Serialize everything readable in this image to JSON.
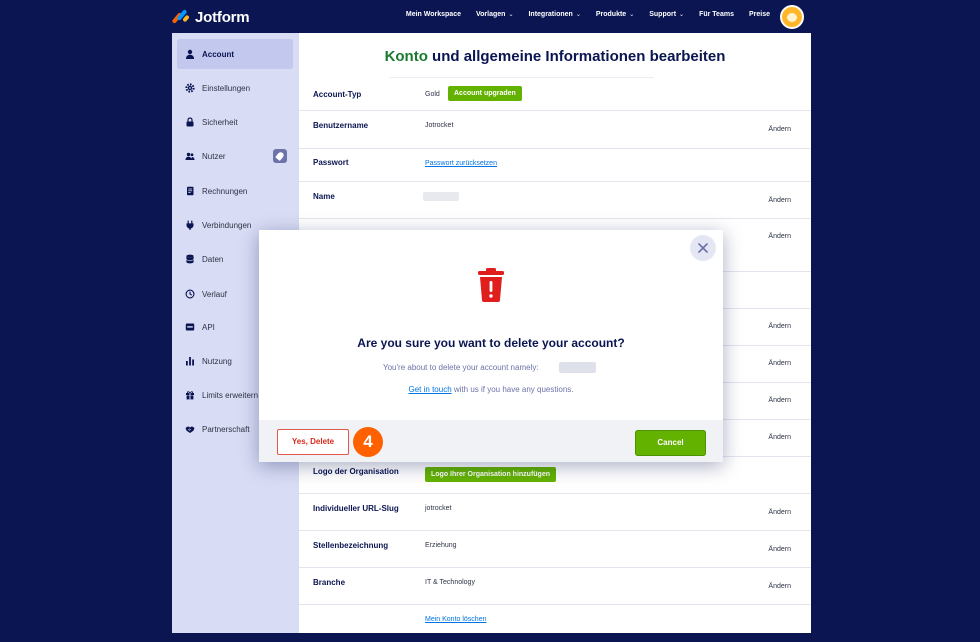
{
  "brand": {
    "name": "Jotform"
  },
  "nav": {
    "links": [
      {
        "label": "Mein Workspace",
        "dropdown": false
      },
      {
        "label": "Vorlagen",
        "dropdown": true
      },
      {
        "label": "Integrationen",
        "dropdown": true
      },
      {
        "label": "Produkte",
        "dropdown": true
      },
      {
        "label": "Support",
        "dropdown": true
      },
      {
        "label": "Für Teams",
        "dropdown": false
      },
      {
        "label": "Preise",
        "dropdown": false
      }
    ],
    "caret": "⌄"
  },
  "sidebar": {
    "items": [
      {
        "label": "Account",
        "icon": "user-icon",
        "active": true
      },
      {
        "label": "Einstellungen",
        "icon": "gear-icon"
      },
      {
        "label": "Sicherheit",
        "icon": "lock-icon"
      },
      {
        "label": "Nutzer",
        "icon": "users-icon"
      },
      {
        "label": "Rechnungen",
        "icon": "invoice-icon"
      },
      {
        "label": "Verbindungen",
        "icon": "plug-icon"
      },
      {
        "label": "Daten",
        "icon": "database-icon"
      },
      {
        "label": "Verlauf",
        "icon": "history-icon"
      },
      {
        "label": "API",
        "icon": "api-icon"
      },
      {
        "label": "Nutzung",
        "icon": "bar-chart-icon"
      },
      {
        "label": "Limits erweitern",
        "icon": "gift-icon"
      },
      {
        "label": "Partnerschaft",
        "icon": "handshake-icon"
      }
    ]
  },
  "main": {
    "title_highlight": "Konto",
    "title_rest": " und allgemeine Informationen bearbeiten",
    "change_label": "Ändern",
    "rows": {
      "account_type": {
        "label": "Account-Typ",
        "value": "Gold",
        "button": "Account upgraden"
      },
      "username": {
        "label": "Benutzername",
        "value": "Jotrocket"
      },
      "password": {
        "label": "Passwort",
        "link": "Passwort zurücksetzen"
      },
      "name": {
        "label": "Name"
      },
      "logo": {
        "label": "Logo der Organisation",
        "button": "Logo Ihrer Organisation hinzufügen"
      },
      "slug": {
        "label": "Individueller URL-Slug",
        "value": "jotrocket"
      },
      "job": {
        "label": "Stellenbezeichnung",
        "value": "Erziehung"
      },
      "industry": {
        "label": "Branche",
        "value": "IT & Technology"
      },
      "delete": {
        "link": "Mein Konto löschen"
      }
    }
  },
  "modal": {
    "title": "Are you sure you want to delete your account?",
    "subtitle": "You're about to delete your account namely:",
    "contact_link": "Get in touch",
    "contact_rest": " with us if you have any questions.",
    "yes_button": "Yes, Delete",
    "step_number": "4",
    "cancel_button": "Cancel"
  },
  "colors": {
    "navy": "#0a1551",
    "green": "#64b200",
    "danger": "#d6291c",
    "step": "#ff6100"
  }
}
